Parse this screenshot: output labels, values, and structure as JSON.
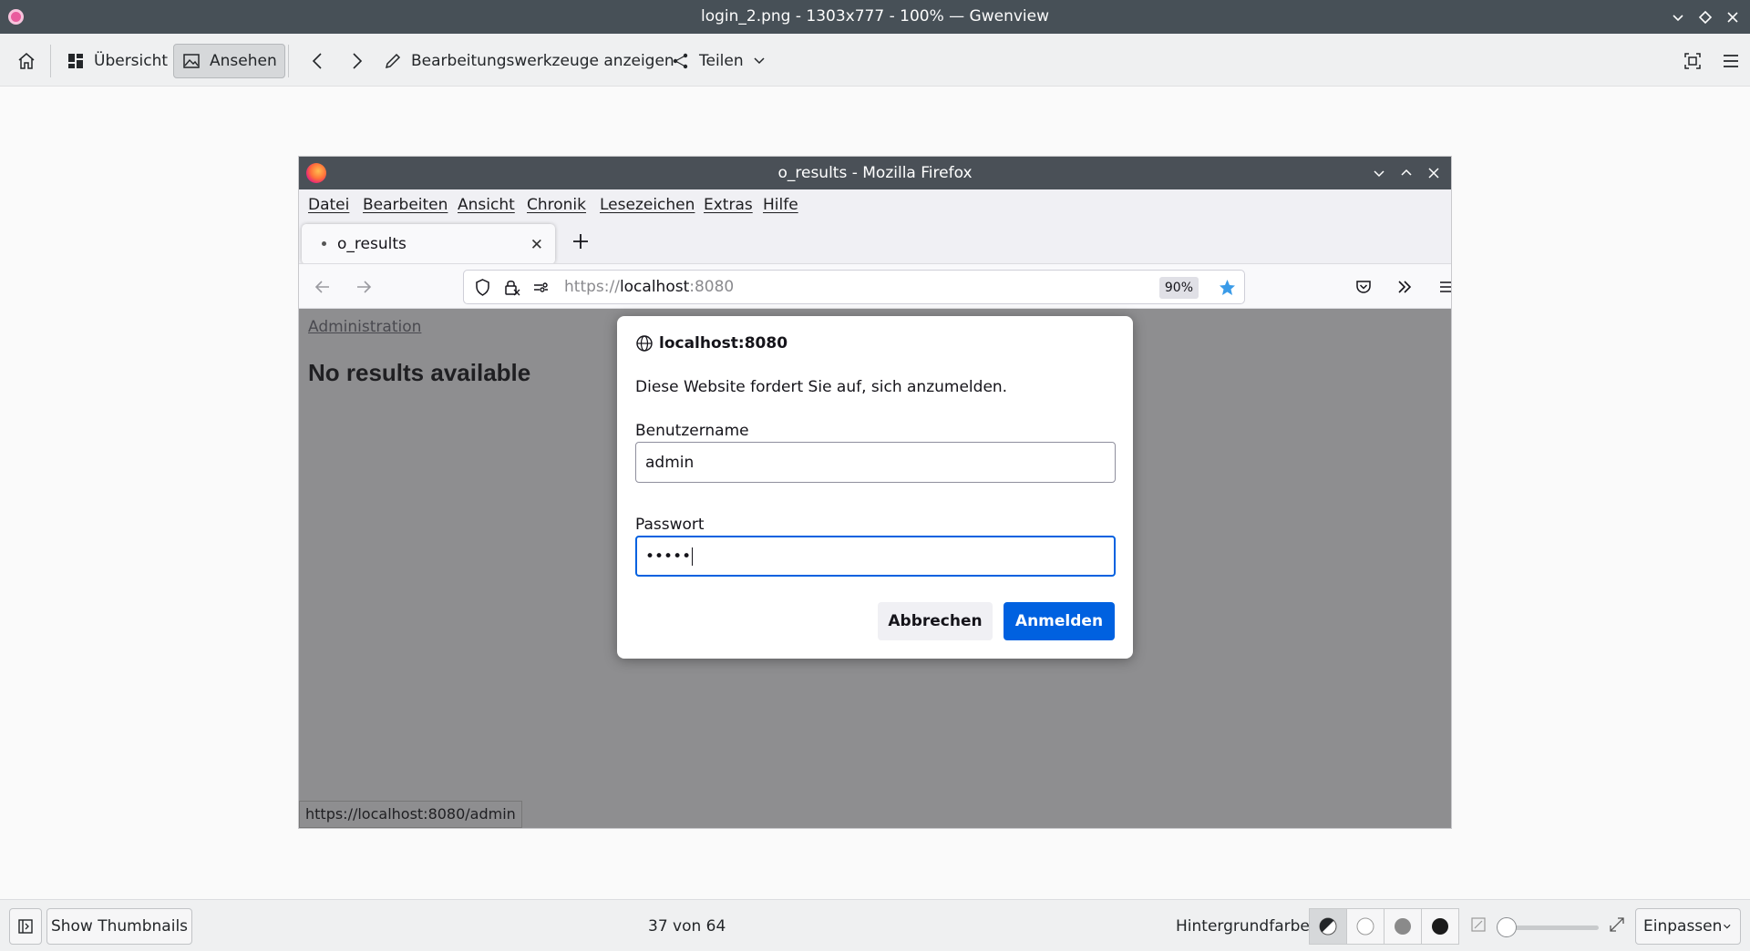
{
  "window": {
    "title": "login_2.png - 1303x777 - 100% — Gwenview"
  },
  "toolbar": {
    "overview_label": "Übersicht",
    "view_label": "Ansehen",
    "edit_tools_label": "Bearbeitungswerkzeuge anzeigen",
    "share_label": "Teilen"
  },
  "image": {
    "firefox": {
      "title": "o_results - Mozilla Firefox",
      "menu": [
        "Datei",
        "Bearbeiten",
        "Ansicht",
        "Chronik",
        "Lesezeichen",
        "Extras",
        "Hilfe"
      ],
      "tab_label": "o_results",
      "url_scheme": "https://",
      "url_host": "localhost",
      "url_port": ":8080",
      "zoom": "90%",
      "page": {
        "admin_link": "Administration",
        "heading": "No results available"
      },
      "status_url": "https://localhost:8080/admin"
    },
    "dialog": {
      "host": "localhost:8080",
      "message": "Diese Website fordert Sie auf, sich anzumelden.",
      "username_label": "Benutzername",
      "username_value": "admin",
      "password_label": "Passwort",
      "password_value": "•••••",
      "cancel_label": "Abbrechen",
      "submit_label": "Anmelden"
    }
  },
  "statusbar": {
    "thumbnails_label": "Show Thumbnails",
    "position": "37 von 64",
    "background_label": "Hintergrundfarbe:",
    "zoom_mode": "Einpassen"
  },
  "colors": {
    "accent": "#0061e0",
    "titlebar": "#475057",
    "dimmed_page": "#8e8e90"
  }
}
